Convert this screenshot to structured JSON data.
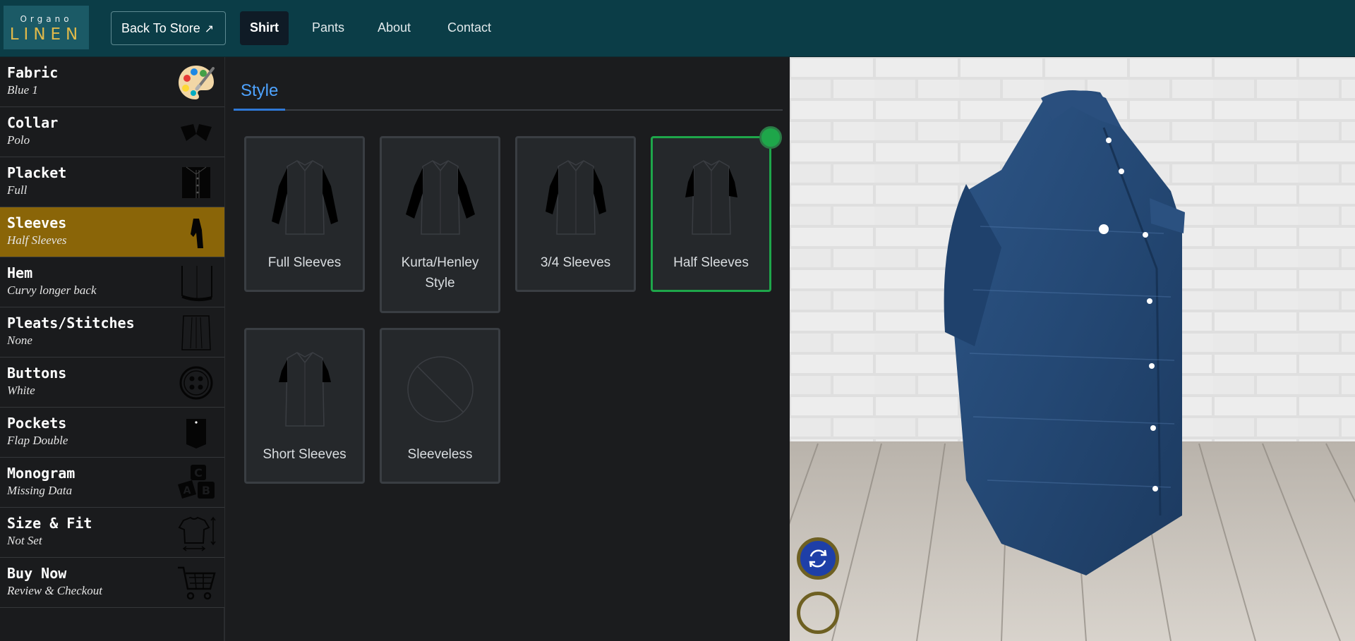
{
  "brand": {
    "top": "Organo",
    "main": "LINEN"
  },
  "header": {
    "back_label": "Back To Store",
    "nav": [
      {
        "label": "Shirt"
      },
      {
        "label": "Pants"
      },
      {
        "label": "About"
      },
      {
        "label": "Contact"
      }
    ]
  },
  "sidebar": {
    "items": [
      {
        "title": "Fabric",
        "value": "Blue 1",
        "icon": "palette-icon"
      },
      {
        "title": "Collar",
        "value": "Polo",
        "icon": "collar-icon"
      },
      {
        "title": "Placket",
        "value": "Full",
        "icon": "placket-icon"
      },
      {
        "title": "Sleeves",
        "value": "Half Sleeves",
        "icon": "sleeve-icon"
      },
      {
        "title": "Hem",
        "value": "Curvy longer back",
        "icon": "hem-icon"
      },
      {
        "title": "Pleats/Stitches",
        "value": "None",
        "icon": "pleats-icon"
      },
      {
        "title": "Buttons",
        "value": "White",
        "icon": "button-icon"
      },
      {
        "title": "Pockets",
        "value": "Flap Double",
        "icon": "pocket-icon"
      },
      {
        "title": "Monogram",
        "value": "Missing Data",
        "icon": "monogram-blocks-icon"
      },
      {
        "title": "Size & Fit",
        "value": "Not Set",
        "icon": "tshirt-measure-icon"
      },
      {
        "title": "Buy Now",
        "value": "Review & Checkout",
        "icon": "cart-icon"
      }
    ],
    "active_index": 3
  },
  "panel": {
    "tab": "Style",
    "options": [
      {
        "label": "Full Sleeves"
      },
      {
        "label": "Kurta/Henley Style"
      },
      {
        "label": "3/4 Sleeves"
      },
      {
        "label": "Half Sleeves"
      },
      {
        "label": "Short Sleeves"
      },
      {
        "label": "Sleeveless"
      }
    ],
    "selected": "Half Sleeves"
  },
  "viewer": {
    "controls": [
      "rotate-icon",
      "secondary-view-icon"
    ]
  },
  "colors": {
    "header_bg": "#0b3d47",
    "active_sidebar": "#8a6508",
    "selected_border": "#1ea64a",
    "tab_accent": "#4ea3ff",
    "shirt": "#2c4d78"
  }
}
